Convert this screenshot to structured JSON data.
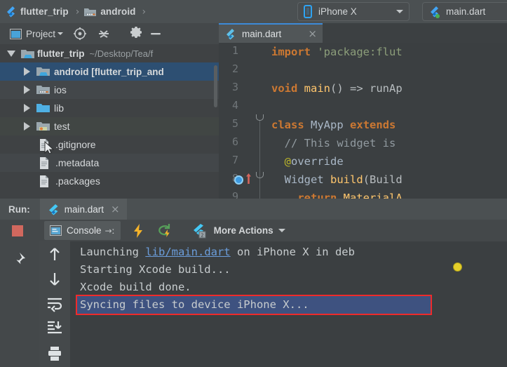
{
  "navbar": {
    "crumbs": [
      {
        "label": "flutter_trip",
        "icon": "flutter-logo-icon"
      },
      {
        "label": "android",
        "icon": "folder-android-icon"
      }
    ],
    "separator": "›",
    "device_selector": {
      "label": "iPhone X",
      "icon": "phone-icon",
      "caret": "chevron-down-icon"
    },
    "run_config": {
      "label": "main.dart",
      "icon": "flutter-dart-icon"
    }
  },
  "project_pane": {
    "toolbar": {
      "title": "Project",
      "caret": "chevron-down-icon",
      "icons": [
        "locate-icon",
        "collapse-all-icon",
        "settings-gear-icon",
        "hide-icon"
      ]
    },
    "tree": [
      {
        "label": "flutter_trip",
        "path": "~/Desktop/Tea/f",
        "depth": 0,
        "state": "expanded",
        "icon": "module-folder-icon",
        "selected": false
      },
      {
        "label": "android [flutter_trip_and",
        "path": "",
        "depth": 1,
        "state": "collapsed",
        "icon": "module-folder-icon",
        "selected": true
      },
      {
        "label": "ios",
        "path": "",
        "depth": 1,
        "state": "collapsed",
        "icon": "module-folder-icon",
        "selected": false
      },
      {
        "label": "lib",
        "path": "",
        "depth": 1,
        "state": "collapsed",
        "icon": "source-folder-icon",
        "selected": false
      },
      {
        "label": "test",
        "path": "",
        "depth": 1,
        "state": "collapsed",
        "icon": "test-folder-icon",
        "selected": false
      },
      {
        "label": ".gitignore",
        "path": "",
        "depth": 1,
        "state": "file",
        "icon": "file-icon",
        "selected": false
      },
      {
        "label": ".metadata",
        "path": "",
        "depth": 1,
        "state": "file",
        "icon": "file-icon",
        "selected": false
      },
      {
        "label": ".packages",
        "path": "",
        "depth": 1,
        "state": "file",
        "icon": "file-icon",
        "selected": false
      }
    ]
  },
  "editor": {
    "tab": {
      "label": "main.dart",
      "close": "×",
      "icon": "dart-file-icon"
    },
    "line_numbers": [
      "1",
      "2",
      "3",
      "4",
      "5",
      "6",
      "7",
      "8",
      "9"
    ],
    "lines": [
      "import 'package:flut",
      "",
      "void main() => runAp",
      "",
      "class MyApp extends ",
      "  // This widget is ",
      "  @override",
      "  Widget build(Build",
      "    return MaterialA"
    ],
    "gutter_markers": {
      "line": "8",
      "run_icon": "run-breakpoint-icon",
      "arrow_icon": "arrow-up-icon"
    }
  },
  "run_panel": {
    "header": {
      "label": "Run:",
      "tab_label": "main.dart",
      "tab_close": "×",
      "tab_icon": "flutter-icon"
    },
    "toolbar": {
      "stop": "stop-button",
      "console_tab": "Console",
      "console_arrow": "→ː",
      "hot_reload": "hot-reload-icon",
      "hot_restart": "hot-restart-icon",
      "inspector": "flutter-inspector-icon",
      "more_actions": "More Actions",
      "more_caret": "chevron-down-icon"
    },
    "left_rail": [
      "pin-icon"
    ],
    "side_rail": [
      "arrow-up-icon",
      "arrow-down-icon",
      "soft-wrap-icon",
      "scroll-to-end-icon",
      "print-icon"
    ],
    "console": {
      "lines": [
        {
          "pre": "Launching ",
          "link": "lib/main.dart",
          "post": " on iPhone X in deb",
          "selected": false
        },
        {
          "pre": "Starting Xcode build...",
          "link": "",
          "post": "",
          "selected": false
        },
        {
          "pre": "Xcode build done.",
          "link": "",
          "post": "",
          "selected": false
        },
        {
          "pre": "Syncing files to device iPhone X...",
          "link": "",
          "post": "",
          "selected": true
        }
      ],
      "marker": "gold-dot-marker"
    }
  },
  "colors": {
    "selection_blue": "#3e5280",
    "annotation_red": "#ef2b2b",
    "accent_blue": "#3d8ad8",
    "link_blue": "#6b9ddb",
    "keyword_orange": "#cc7832",
    "string_green": "#8c9e7a",
    "marker_gold": "#e5cf2a",
    "stop_red": "#d1685e"
  }
}
